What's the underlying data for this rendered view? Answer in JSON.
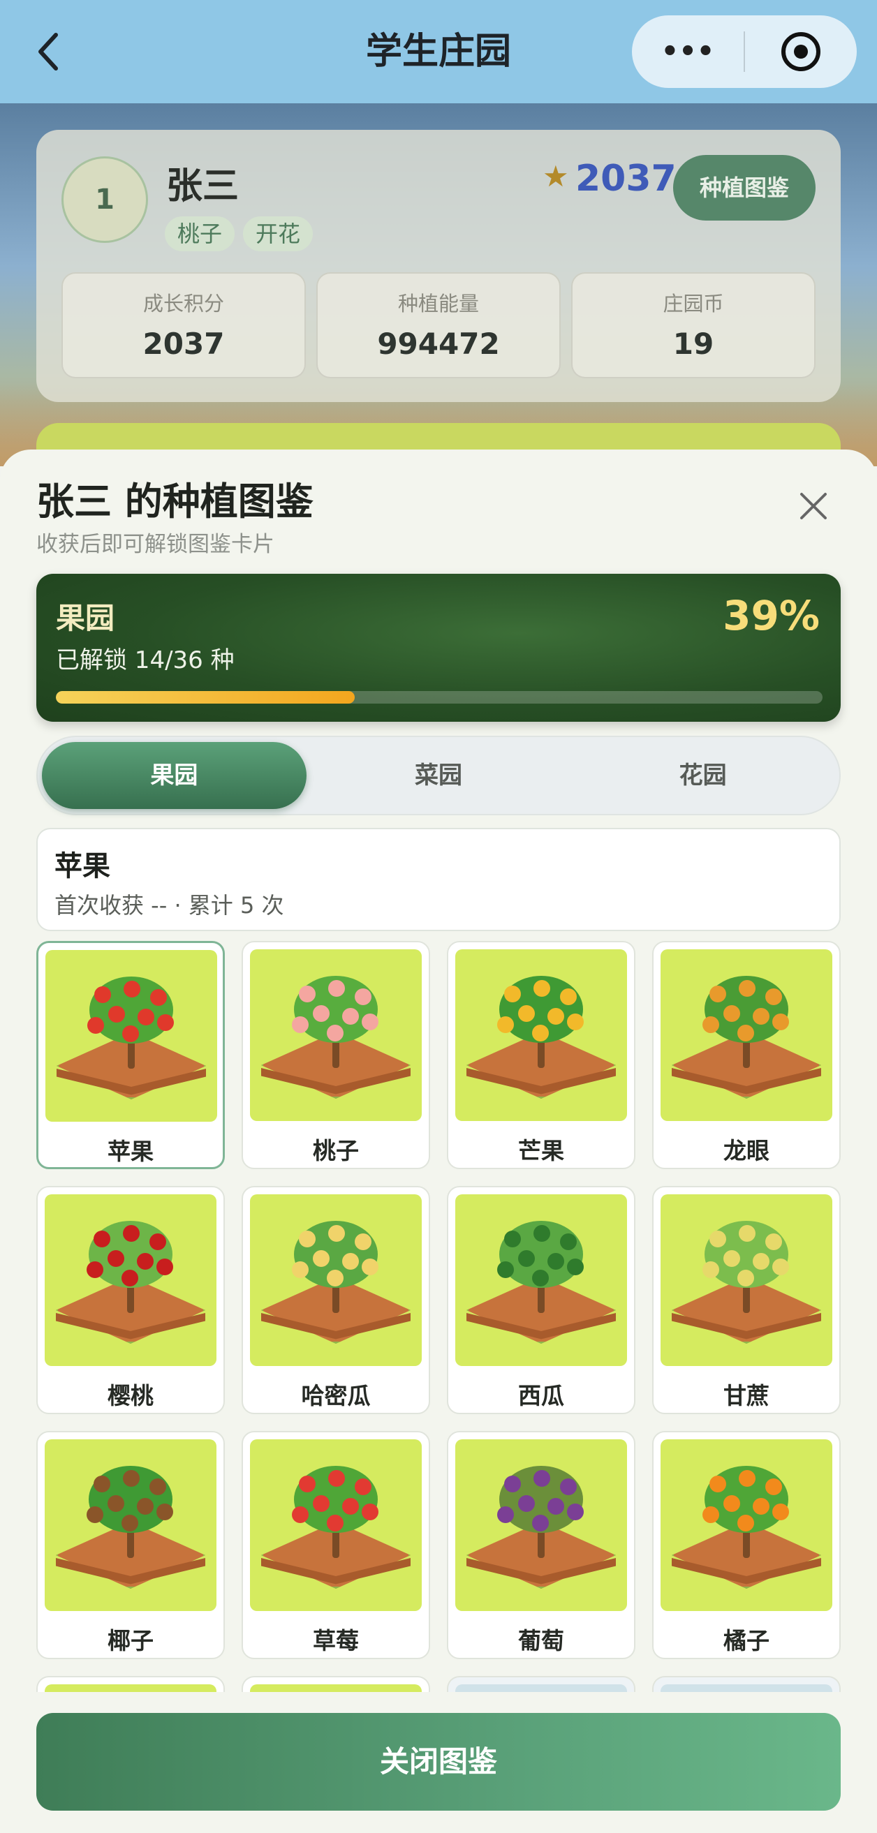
{
  "nav": {
    "title": "学生庄园",
    "more_glyph": "•••",
    "record_glyph": "◉"
  },
  "profile": {
    "rank": "1",
    "name": "张三",
    "tags": [
      "桃子",
      "开花"
    ],
    "score": "2037",
    "plant_book_button": "种植图鉴",
    "stats": [
      {
        "label": "成长积分",
        "value": "2037"
      },
      {
        "label": "种植能量",
        "value": "994472"
      },
      {
        "label": "庄园币",
        "value": "19"
      }
    ]
  },
  "sheet": {
    "title": "张三 的种植图鉴",
    "subtitle": "收获后即可解锁图鉴卡片",
    "progress": {
      "name": "果园",
      "count_text": "已解锁 14/36 种",
      "percent_text": "39%",
      "percent": 39
    },
    "tabs": [
      {
        "label": "果园",
        "active": true
      },
      {
        "label": "菜园",
        "active": false
      },
      {
        "label": "花园",
        "active": false
      }
    ],
    "detail": {
      "name": "苹果",
      "info": "首次收获 -- · 累计 5 次"
    },
    "plants": [
      {
        "label": "苹果",
        "icon": "apple-tree-icon",
        "fruit_color": "#e0392b",
        "canopy": "#4fa637"
      },
      {
        "label": "桃子",
        "icon": "peach-tree-icon",
        "fruit_color": "#f4a6a0",
        "canopy": "#58ad3e"
      },
      {
        "label": "芒果",
        "icon": "mango-tree-icon",
        "fruit_color": "#f2b92a",
        "canopy": "#3f9a34"
      },
      {
        "label": "龙眼",
        "icon": "longan-tree-icon",
        "fruit_color": "#e89a2c",
        "canopy": "#4a9c35"
      },
      {
        "label": "樱桃",
        "icon": "cherry-tree-icon",
        "fruit_color": "#c81e1e",
        "canopy": "#6db548"
      },
      {
        "label": "哈密瓜",
        "icon": "hami-melon-icon",
        "fruit_color": "#f0d36a",
        "canopy": "#5aa843"
      },
      {
        "label": "西瓜",
        "icon": "watermelon-icon",
        "fruit_color": "#2f7b2c",
        "canopy": "#5aa843"
      },
      {
        "label": "甘蔗",
        "icon": "sugarcane-icon",
        "fruit_color": "#e6d96a",
        "canopy": "#7cbd4d"
      },
      {
        "label": "椰子",
        "icon": "coconut-tree-icon",
        "fruit_color": "#8a5529",
        "canopy": "#3f9a34"
      },
      {
        "label": "草莓",
        "icon": "strawberry-icon",
        "fruit_color": "#e23a32",
        "canopy": "#4fa637"
      },
      {
        "label": "葡萄",
        "icon": "grape-vine-icon",
        "fruit_color": "#7b3f95",
        "canopy": "#6b8f3a"
      },
      {
        "label": "橘子",
        "icon": "orange-tree-icon",
        "fruit_color": "#f28a1c",
        "canopy": "#4fa637"
      }
    ],
    "close_button": "关闭图鉴"
  },
  "colors": {
    "nav_bg": "#8fc7e6",
    "accent_green": "#37704f",
    "progress_fill": "#f3a61e",
    "thumb_bg": "#d5eb5f"
  }
}
